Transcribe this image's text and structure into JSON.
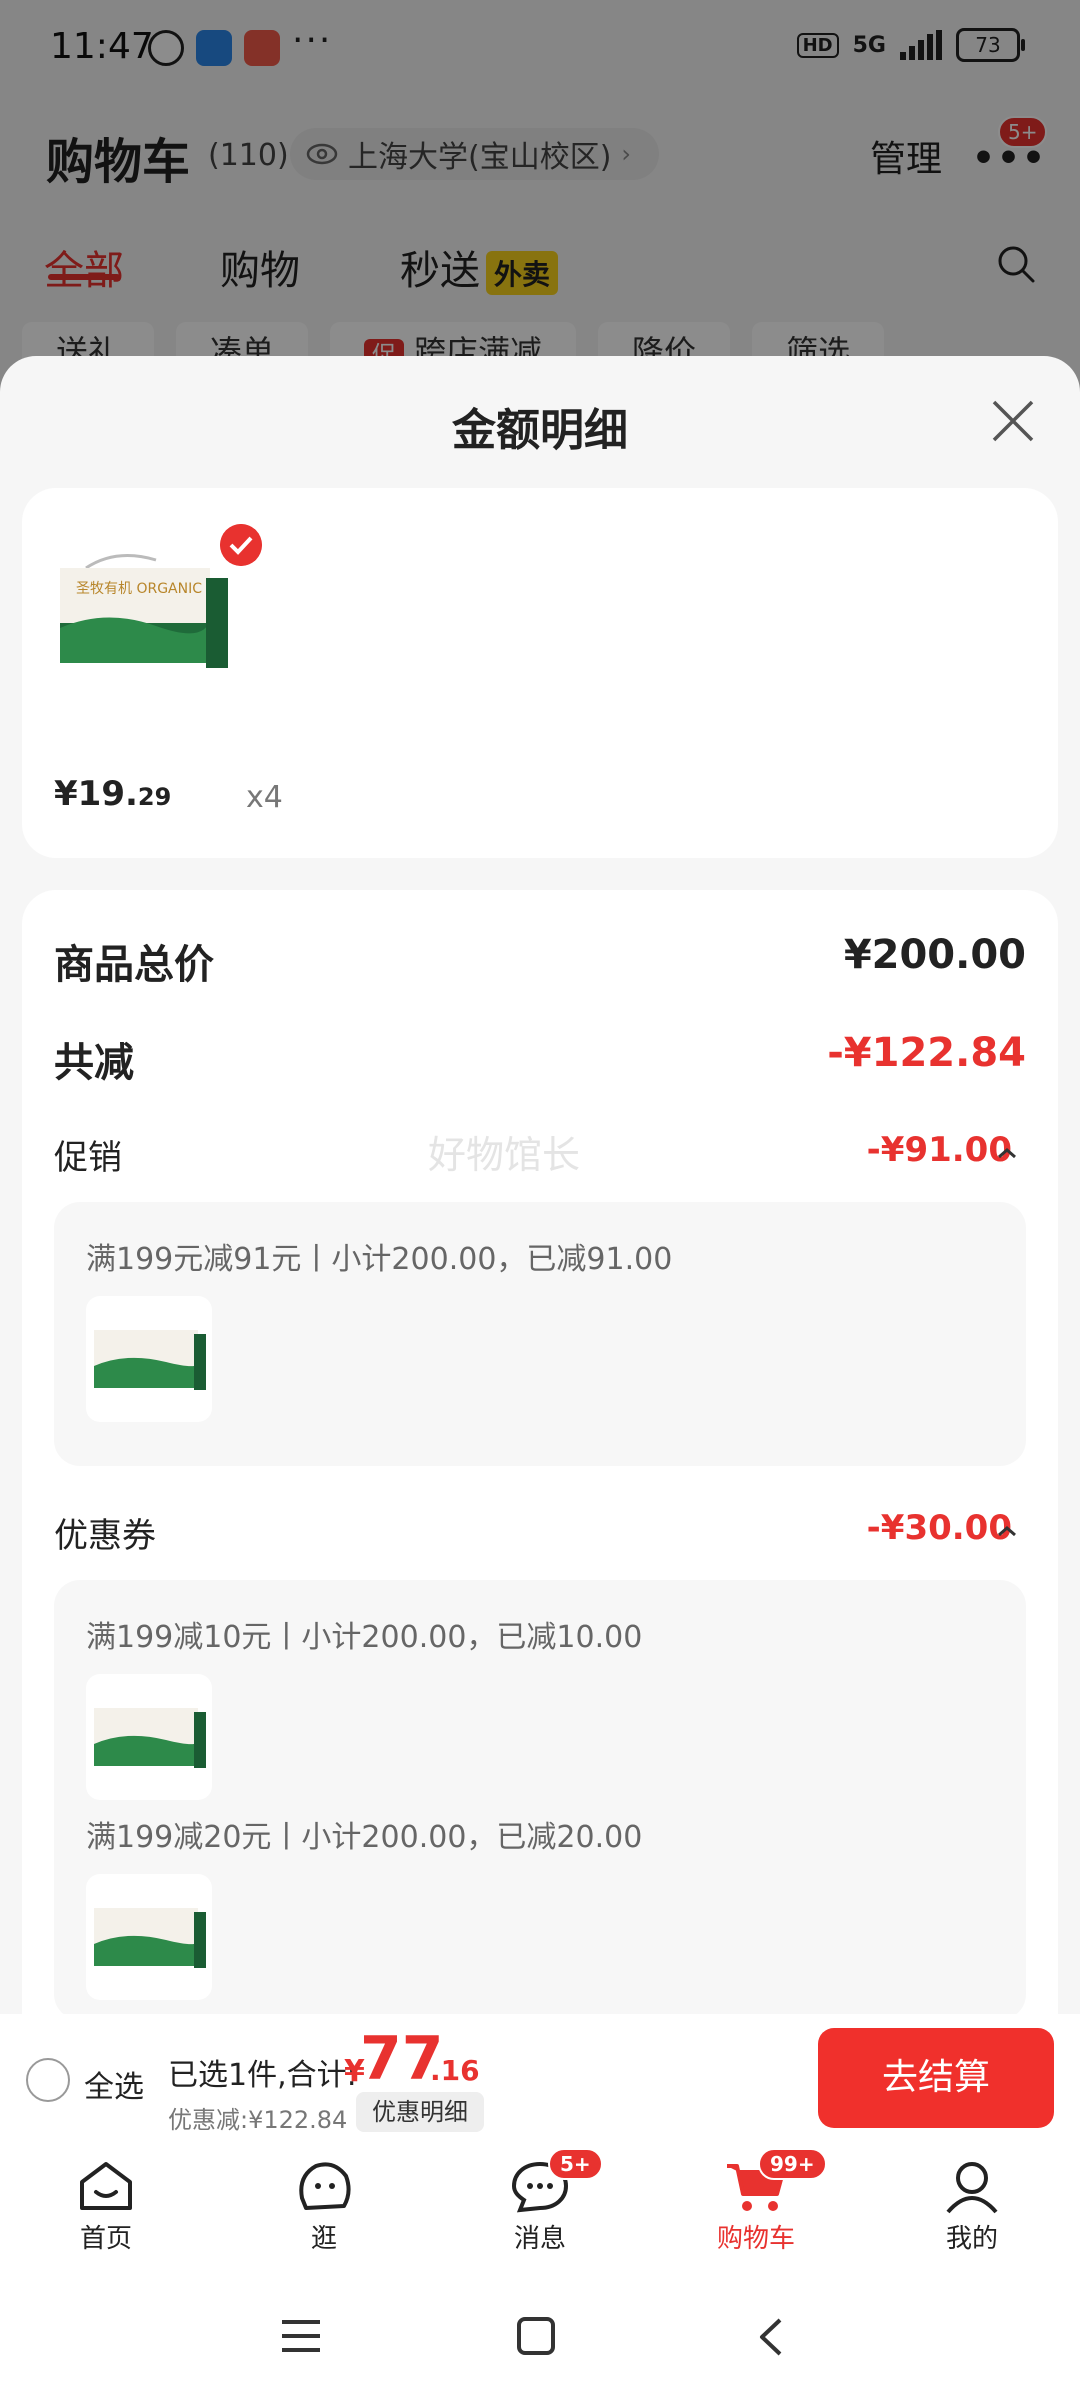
{
  "status_bar": {
    "time": "11:47",
    "network": "5G",
    "battery": "73"
  },
  "header": {
    "title": "购物车",
    "count": "(110)",
    "location": "上海大学(宝山校区)",
    "manage": "管理",
    "more_badge": "5+"
  },
  "tabs": [
    {
      "label": "全部"
    },
    {
      "label": "购物"
    },
    {
      "label": "秒送"
    }
  ],
  "takeout_tag": "外卖",
  "filter_chips": [
    {
      "label": "送礼"
    },
    {
      "label": "凑单"
    },
    {
      "label": "跨店满减",
      "tag": "促"
    },
    {
      "label": "降价"
    },
    {
      "label": "筛选"
    }
  ],
  "sheet": {
    "title": "金额明细",
    "product": {
      "price_int": "¥19.",
      "price_dec": "29",
      "qty": "x4",
      "box_text": "圣牧有机 ORGANIC"
    },
    "total_label": "商品总价",
    "total_value": "¥200.00",
    "reduce_label": "共减",
    "reduce_value": "-¥122.84",
    "promo_label": "促销",
    "promo_value": "-¥91.00",
    "watermark": "好物馆长",
    "promo_group": "满199元减91元丨小计200.00，已减91.00",
    "coupon_label": "优惠券",
    "coupon_value": "-¥30.00",
    "coupon_groups": [
      "满199减10元丨小计200.00，已减10.00",
      "满199减20元丨小计200.00，已减20.00"
    ]
  },
  "bottom_bar": {
    "select_all": "全选",
    "selected_text": "已选1件,合计:",
    "total_yen": "¥",
    "total_int": "77",
    "total_dec": ".16",
    "discount": "优惠减:¥122.84",
    "discount_detail": "优惠明细",
    "checkout": "去结算"
  },
  "nav": [
    {
      "label": "首页"
    },
    {
      "label": "逛"
    },
    {
      "label": "消息",
      "badge": "5+"
    },
    {
      "label": "购物车",
      "badge": "99+"
    },
    {
      "label": "我的"
    }
  ],
  "colors": {
    "accent": "#e8322f",
    "takeout": "#f7d21c"
  }
}
